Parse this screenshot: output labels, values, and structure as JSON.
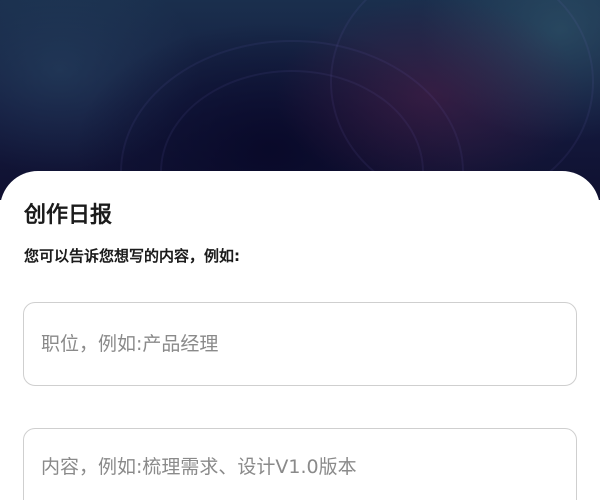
{
  "header": {
    "title": "创作日报",
    "subtitle": "您可以告诉您想写的内容，例如:"
  },
  "form": {
    "position_field": {
      "value": "",
      "placeholder": "职位，例如:产品经理"
    },
    "content_field": {
      "value": "",
      "placeholder": "内容，例如:梳理需求、设计V1.0版本"
    }
  }
}
